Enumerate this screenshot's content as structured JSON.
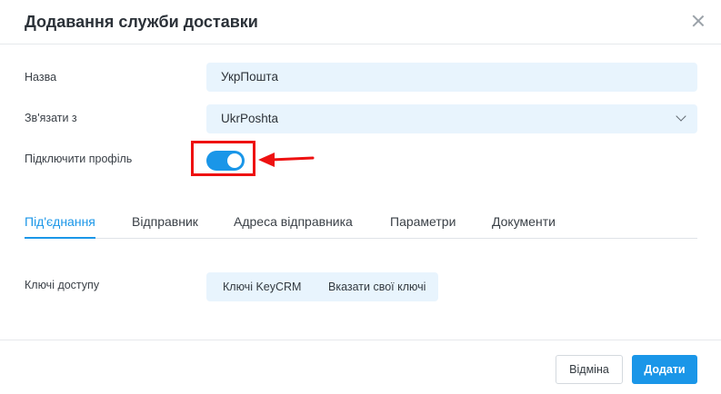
{
  "dialog": {
    "title": "Додавання служби доставки"
  },
  "form": {
    "name_label": "Назва",
    "name_value": "УкрПошта",
    "link_label": "Зв'язати з",
    "link_value": "UkrPoshta",
    "profile_label": "Підключити профіль",
    "profile_enabled": true
  },
  "tabs": [
    {
      "label": "Під'єднання",
      "active": true
    },
    {
      "label": "Відправник",
      "active": false
    },
    {
      "label": "Адреса відправника",
      "active": false
    },
    {
      "label": "Параметри",
      "active": false
    },
    {
      "label": "Документи",
      "active": false
    }
  ],
  "access": {
    "label": "Ключі доступу",
    "option_keycrm": "Ключі KeyCRM",
    "option_own": "Вказати свої ключі"
  },
  "footer": {
    "cancel_label": "Відміна",
    "add_label": "Додати"
  },
  "colors": {
    "accent": "#1a96e8",
    "field_bg": "#e8f4fd",
    "annotation": "#ee1111"
  },
  "icons": {
    "close": "close-icon",
    "dropdown": "chevron-down-icon",
    "annotation": "red-arrow-icon"
  }
}
